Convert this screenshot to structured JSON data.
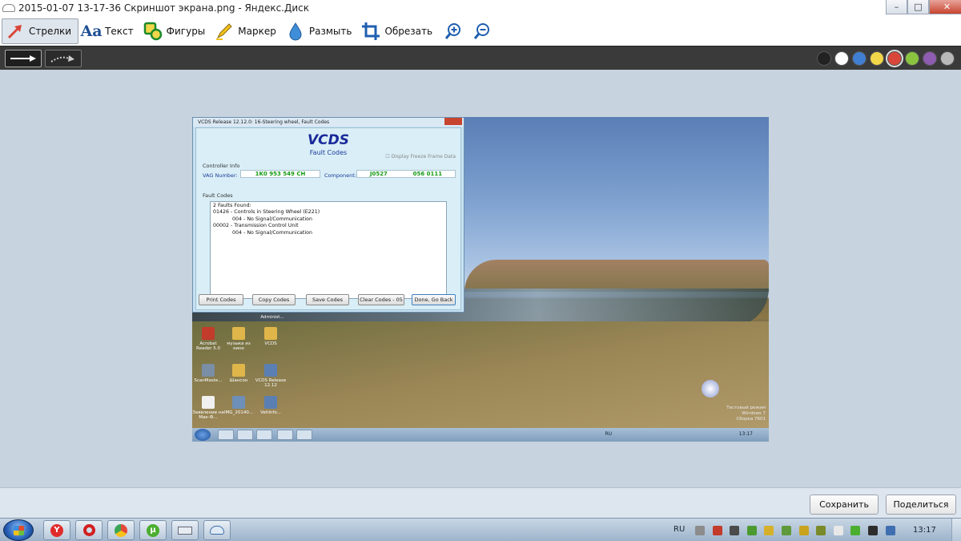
{
  "window": {
    "title": "2015-01-07 13-17-36 Скриншот экрана.png - Яндекс.Диск",
    "minimize": "–",
    "maximize": "□",
    "close": "✕"
  },
  "toolbar": {
    "tools": [
      {
        "label": "Стрелки",
        "icon": "arrow-icon"
      },
      {
        "label": "Текст",
        "icon": "text-icon"
      },
      {
        "label": "Фигуры",
        "icon": "shapes-icon"
      },
      {
        "label": "Маркер",
        "icon": "marker-icon"
      },
      {
        "label": "Размыть",
        "icon": "blur-icon"
      },
      {
        "label": "Обрезать",
        "icon": "crop-icon"
      }
    ],
    "text_icon_glyph": "Aa",
    "zoom_in": "zoom-in-icon",
    "zoom_out": "zoom-out-icon"
  },
  "palette": {
    "colors": [
      "#222222",
      "#ffffff",
      "#3f7ed1",
      "#f2d64a",
      "#d9473a",
      "#8ac43f",
      "#8e5cb0",
      "#b9b9b9"
    ],
    "selected": "#d9473a"
  },
  "vcds": {
    "title": "VCDS Release 12.12.0: 16-Steering wheel,  Fault Codes",
    "heading": "VCDS",
    "subheading": "Fault Codes",
    "freeze_frame": "Display Freeze Frame Data",
    "controller_info": "Controller Info",
    "vag_label": "VAG Number:",
    "vag_number": "1K0 953 549 CH",
    "component_label": "Component:",
    "component_a": "J0527",
    "component_b": "056 0111",
    "fault_codes": "Fault Codes",
    "fault_text": "2 Faults Found:\n01426 - Controls in Steering Wheel (E221)\n            004 - No Signal/Communication\n00002 - Transmission Control Unit\n            004 - No Signal/Communication",
    "buttons": [
      "Print Codes",
      "Copy Codes",
      "Save Codes",
      "Clear Codes - 05",
      "Done, Go Back"
    ]
  },
  "desktop": {
    "admin_label": "Administ...",
    "icons": [
      {
        "label": "Acrobat Reader 5.0"
      },
      {
        "label": "музыка из кино"
      },
      {
        "label": "VCDS"
      },
      {
        "label": "ScanMaste..."
      },
      {
        "label": "Шансон"
      },
      {
        "label": "VCDS Release 12.12"
      },
      {
        "label": "Заявление на Мак-Ф..."
      },
      {
        "label": "IMG_20140..."
      },
      {
        "label": "VehInfo..."
      }
    ],
    "watermark": [
      "Тестовый режим",
      "Windows 7",
      "Сборка 7601"
    ],
    "inner_clock": "13:17",
    "inner_lang": "RU"
  },
  "footer": {
    "save": "Сохранить",
    "share": "Поделиться"
  },
  "taskbar": {
    "lang": "RU",
    "clock": "13:17"
  }
}
